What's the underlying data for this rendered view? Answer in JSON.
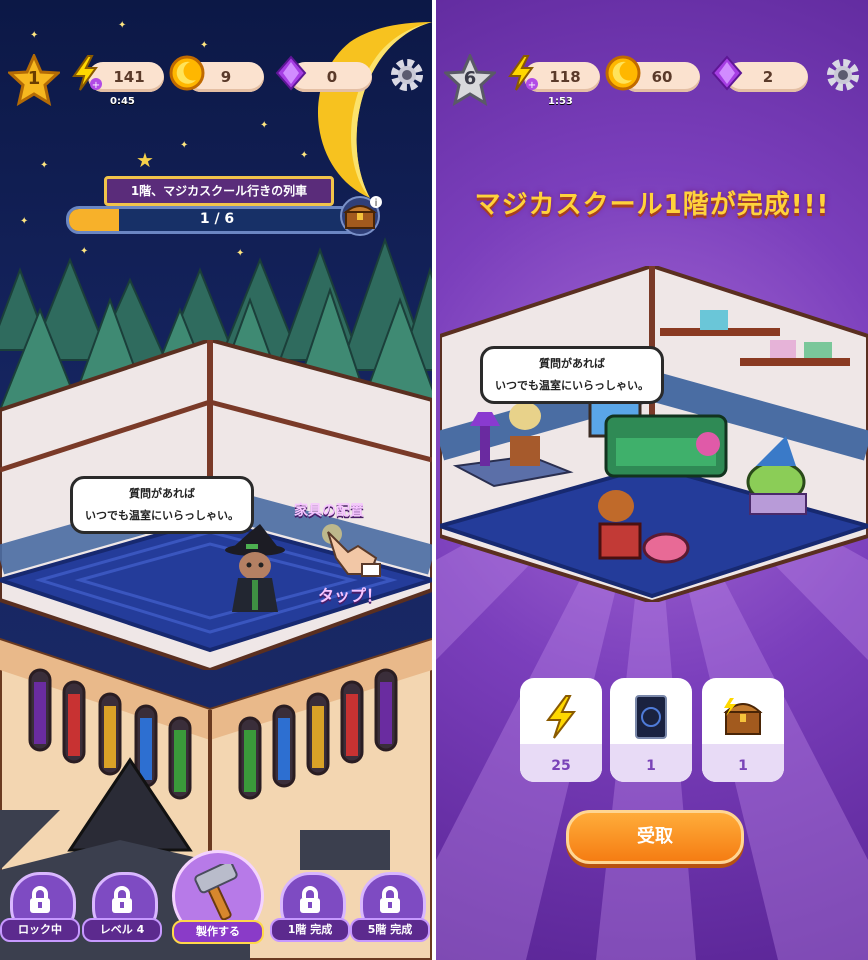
{
  "left": {
    "top_bar": {
      "level": "1",
      "energy": "141",
      "energy_timer": "0:45",
      "coins": "9",
      "gems": "0"
    },
    "quest": {
      "title": "1階、マジカスクール行きの列車",
      "progress_text": "1 / 6",
      "progress": 0.17
    },
    "speech_bubble": {
      "line1": "質問があれば",
      "line2": "いつでも温室にいらっしゃい。"
    },
    "hint": {
      "furniture_label": "家具の配置",
      "tap_label": "タップ！"
    },
    "bottom_buttons": [
      {
        "label": "ロック中"
      },
      {
        "label": "レベル 4"
      },
      {
        "label": "製作する"
      },
      {
        "label": "1階 完成"
      },
      {
        "label": "5階 完成"
      }
    ]
  },
  "right": {
    "top_bar": {
      "level": "6",
      "energy": "118",
      "energy_timer": "1:53",
      "coins": "60",
      "gems": "2"
    },
    "title": "マジカスクール1階が完成!!!",
    "speech_bubble": {
      "line1": "質問があれば",
      "line2": "いつでも温室にいらっしゃい。"
    },
    "rewards": [
      {
        "icon": "lightning-icon",
        "value": "25"
      },
      {
        "icon": "card-icon",
        "value": "1"
      },
      {
        "icon": "chest-icon",
        "value": "1"
      }
    ],
    "claim_label": "受取"
  },
  "colors": {
    "night_sky": "#15245f",
    "purple_bg": "#7b3fbc",
    "gold": "#ffd23b",
    "orange_button": "#f57d13"
  }
}
